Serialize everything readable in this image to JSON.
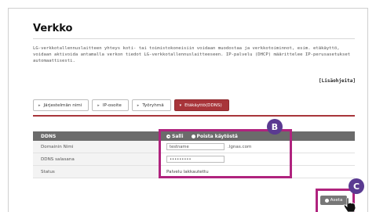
{
  "page": {
    "title": "Verkko",
    "description": "LG-verkkotallennuslaitteen yhteys koti- tai toimistokoneisiin voidaan muodostaa ja verkkotoiminnot, esim. etäkäyttö, voidaan aktivoida antamalla verkon tiedot LG-verkkotallennuslaitteeseen. IP-palvelu (DHCP) määrittelee IP-perusasetukset automaattisesti.",
    "help_link": "[Lisäohjeita]"
  },
  "tabs": [
    {
      "label": "Järjestelmän nimi",
      "active": false
    },
    {
      "label": "IP-osoite",
      "active": false
    },
    {
      "label": "Työryhmä",
      "active": false
    },
    {
      "label": "Etäkäyttö(DDNS)",
      "active": true
    }
  ],
  "ddns": {
    "header_label": "DDNS",
    "allow_label": "Salli",
    "disable_label": "Poista käytöstä",
    "selected": "Salli",
    "domain_label": "Domainin Nimi",
    "domain_value": "testname",
    "domain_suffix": ".lgnas.com",
    "password_label": "DDNS salasana",
    "password_value": "•••••••••",
    "status_label": "Status",
    "status_value": "Palvelu lakkautettu"
  },
  "buttons": {
    "set_label": "Aseta"
  },
  "callouts": {
    "b": "B",
    "c": "C"
  },
  "colors": {
    "accent": "#a8353a",
    "highlight": "#b0237e",
    "callout": "#5a3a91",
    "header": "#6b6b6b"
  }
}
